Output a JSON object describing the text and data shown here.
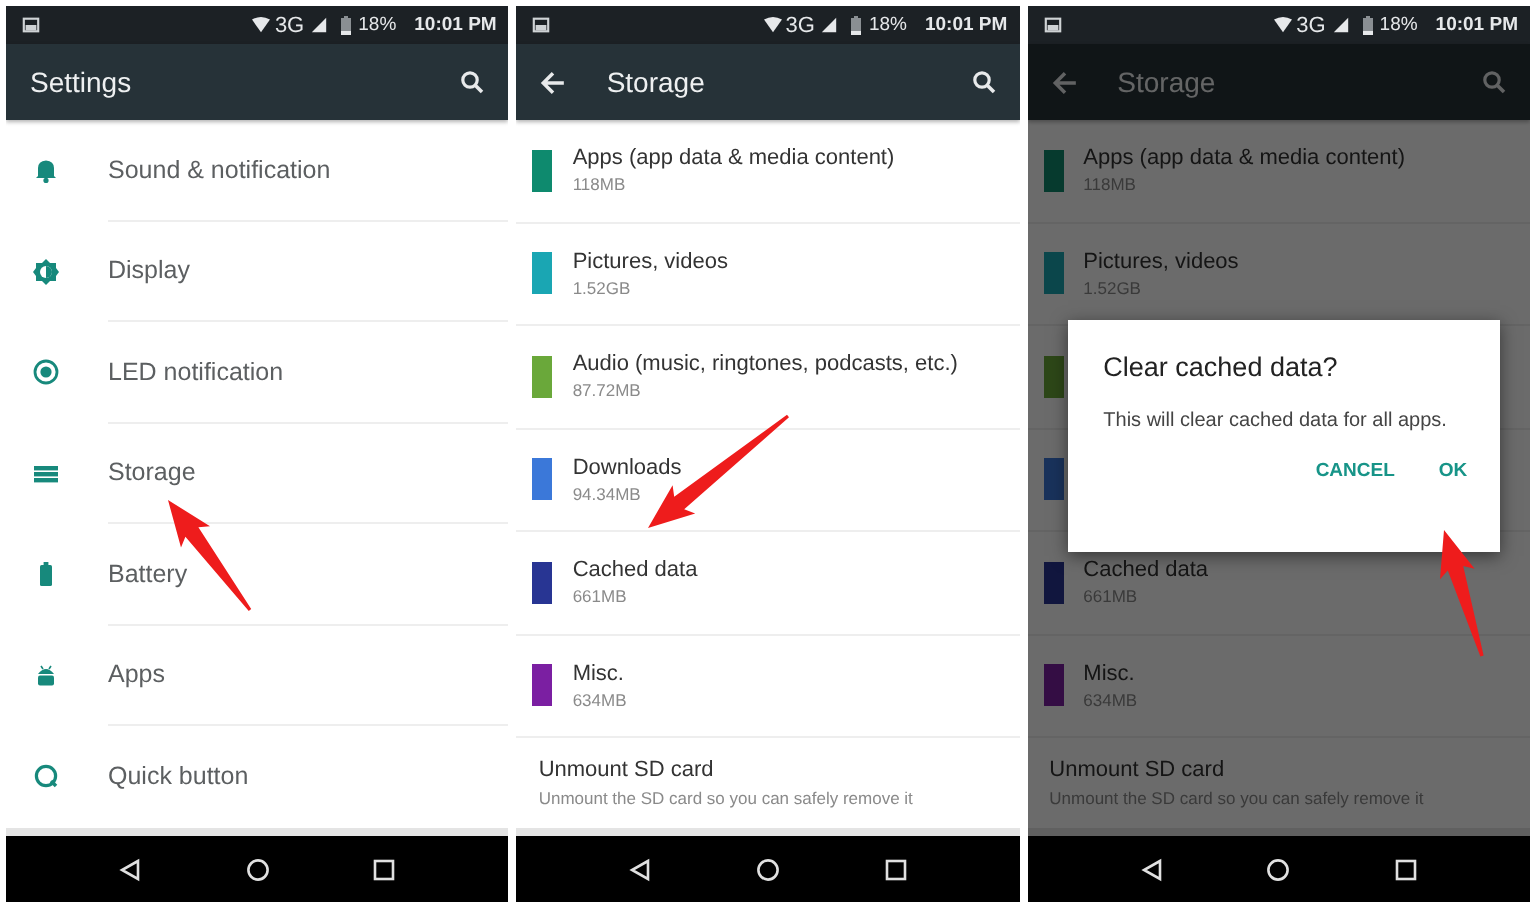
{
  "panels": [
    {
      "kind": "settings",
      "status": {
        "network": "3G",
        "battery": "18%",
        "time": "10:01 PM"
      },
      "toolbar": {
        "title": "Settings",
        "back": false
      },
      "items": [
        {
          "label": "Sound & notification"
        },
        {
          "label": "Display"
        },
        {
          "label": "LED notification"
        },
        {
          "label": "Storage"
        },
        {
          "label": "Battery"
        },
        {
          "label": "Apps"
        },
        {
          "label": "Quick button"
        }
      ]
    },
    {
      "kind": "storage",
      "status": {
        "network": "3G",
        "battery": "18%",
        "time": "10:01 PM"
      },
      "toolbar": {
        "title": "Storage",
        "back": true
      },
      "items": [
        {
          "label": "Apps (app data & media content)",
          "size": "118MB",
          "color": "#0e8a6e"
        },
        {
          "label": "Pictures, videos",
          "size": "1.52GB",
          "color": "#1aa6b3"
        },
        {
          "label": "Audio (music, ringtones, podcasts, etc.)",
          "size": "87.72MB",
          "color": "#6aa83a"
        },
        {
          "label": "Downloads",
          "size": "94.34MB",
          "color": "#3b78d9"
        },
        {
          "label": "Cached data",
          "size": "661MB",
          "color": "#283593"
        },
        {
          "label": "Misc.",
          "size": "634MB",
          "color": "#7b1fa2"
        }
      ],
      "footer": {
        "title": "Unmount SD card",
        "subtitle": "Unmount the SD card so you can safely remove it"
      }
    },
    {
      "kind": "storage",
      "status": {
        "network": "3G",
        "battery": "18%",
        "time": "10:01 PM"
      },
      "toolbar": {
        "title": "Storage",
        "back": true
      },
      "items": [
        {
          "label": "Apps (app data & media content)",
          "size": "118MB",
          "color": "#063a2e"
        },
        {
          "label": "Pictures, videos",
          "size": "1.52GB",
          "color": "#0b464b"
        },
        {
          "color": "#2d4718"
        },
        {
          "color": "#19325b"
        },
        {
          "label": "Cached data",
          "size": "661MB",
          "color": "#11163e"
        },
        {
          "label": "Misc.",
          "size": "634MB",
          "color": "#340d44"
        }
      ],
      "footer": {
        "title": "Unmount SD card",
        "subtitle": "Unmount the SD card so you can safely remove it"
      },
      "dialog": {
        "title": "Clear cached data?",
        "message": "This will clear cached data for all apps.",
        "buttons": [
          "CANCEL",
          "OK"
        ]
      }
    }
  ]
}
